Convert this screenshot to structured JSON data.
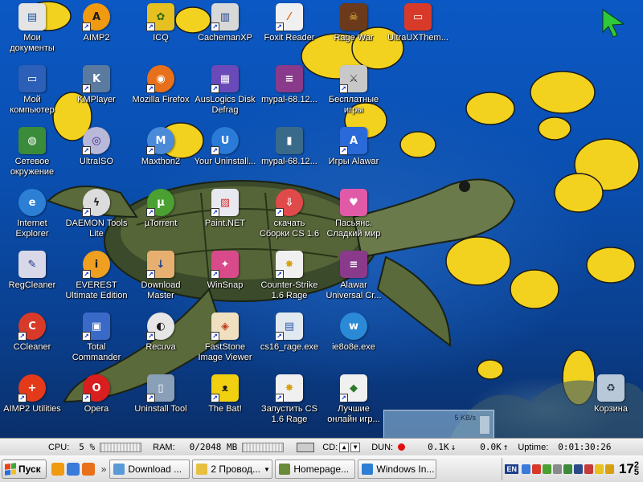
{
  "desktop": {
    "icons": [
      {
        "label": "Мои документы",
        "icon": "my-documents-icon",
        "color": "#e4e4e4",
        "fg": "#1d4f9b",
        "glyph": "▤",
        "shortcut": false
      },
      {
        "label": "Мой компьютер",
        "icon": "my-computer-icon",
        "color": "#2b5fb8",
        "fg": "#ffffff",
        "glyph": "▭",
        "shortcut": false
      },
      {
        "label": "Сетевое окружение",
        "icon": "network-icon",
        "color": "#3a8c3a",
        "fg": "#ffffff",
        "glyph": "◍",
        "shortcut": false
      },
      {
        "label": "Internet Explorer",
        "icon": "internet-explorer-icon",
        "color": "#2c7fd4",
        "fg": "#ffffff",
        "glyph": "e",
        "shortcut": false
      },
      {
        "label": "RegCleaner",
        "icon": "regcleaner-icon",
        "color": "#d8d8e8",
        "fg": "#1d2f8c",
        "glyph": "✎",
        "shortcut": false
      },
      {
        "label": "CCleaner",
        "icon": "ccleaner-icon",
        "color": "#d83a2a",
        "fg": "#ffffff",
        "glyph": "C",
        "shortcut": true
      },
      {
        "label": "AIMP2 Utilities",
        "icon": "aimp2-utilities-icon",
        "color": "#e43a1a",
        "fg": "#ffffff",
        "glyph": "+",
        "shortcut": true
      },
      {
        "label": "AIMP2",
        "icon": "aimp2-icon",
        "color": "#f09a10",
        "fg": "#1a1a1a",
        "glyph": "A",
        "shortcut": true
      },
      {
        "label": "KMPlayer",
        "icon": "kmplayer-icon",
        "color": "#5a7aa0",
        "fg": "#ffffff",
        "glyph": "K",
        "shortcut": true
      },
      {
        "label": "UltraISO",
        "icon": "ultraiso-icon",
        "color": "#b8b8d8",
        "fg": "#4a2a9a",
        "glyph": "◎",
        "shortcut": true
      },
      {
        "label": "DAEMON Tools Lite",
        "icon": "daemon-tools-icon",
        "color": "#dcdcdc",
        "fg": "#2a2a2a",
        "glyph": "ϟ",
        "shortcut": true
      },
      {
        "label": "EVEREST Ultimate Edition",
        "icon": "everest-icon",
        "color": "#f0a020",
        "fg": "#1a1a1a",
        "glyph": "i",
        "shortcut": true
      },
      {
        "label": "Total Commander",
        "icon": "total-commander-icon",
        "color": "#3a6ac8",
        "fg": "#ffffff",
        "glyph": "▣",
        "shortcut": true
      },
      {
        "label": "Opera",
        "icon": "opera-icon",
        "color": "#d81e1e",
        "fg": "#ffffff",
        "glyph": "O",
        "shortcut": true
      },
      {
        "label": "ICQ",
        "icon": "icq-icon",
        "color": "#e6c020",
        "fg": "#2a6a10",
        "glyph": "✿",
        "shortcut": true
      },
      {
        "label": "Mozilla Firefox",
        "icon": "firefox-icon",
        "color": "#e8701a",
        "fg": "#ffffff",
        "glyph": "◉",
        "shortcut": true
      },
      {
        "label": "Maxthon2",
        "icon": "maxthon-icon",
        "color": "#4a8ad8",
        "fg": "#ffffff",
        "glyph": "M",
        "shortcut": true
      },
      {
        "label": "µTorrent",
        "icon": "utorrent-icon",
        "color": "#4aa030",
        "fg": "#ffffff",
        "glyph": "µ",
        "shortcut": true
      },
      {
        "label": "Download Master",
        "icon": "download-master-icon",
        "color": "#e8b070",
        "fg": "#1d3f8c",
        "glyph": "↓",
        "shortcut": true
      },
      {
        "label": "Recuva",
        "icon": "recuva-icon",
        "color": "#e6e6e6",
        "fg": "#1a1a1a",
        "glyph": "◐",
        "shortcut": true
      },
      {
        "label": "Uninstall Tool",
        "icon": "uninstall-tool-icon",
        "color": "#8aa0b8",
        "fg": "#ffffff",
        "glyph": "▯",
        "shortcut": true
      },
      {
        "label": "CachemanXP",
        "icon": "cachemanxp-icon",
        "color": "#d8d8d8",
        "fg": "#1d3f8c",
        "glyph": "▥",
        "shortcut": true
      },
      {
        "label": "AusLogics Disk Defrag",
        "icon": "auslogics-defrag-icon",
        "color": "#6a4ab8",
        "fg": "#ffffff",
        "glyph": "▦",
        "shortcut": true
      },
      {
        "label": "Your Uninstall...",
        "icon": "your-uninstaller-icon",
        "color": "#2a7ad8",
        "fg": "#ffffff",
        "glyph": "U",
        "shortcut": true
      },
      {
        "label": "Paint.NET",
        "icon": "paint-net-icon",
        "color": "#e8e8f0",
        "fg": "#d82a2a",
        "glyph": "▨",
        "shortcut": true
      },
      {
        "label": "WinSnap",
        "icon": "winsnap-icon",
        "color": "#d84a8a",
        "fg": "#ffffff",
        "glyph": "✦",
        "shortcut": true
      },
      {
        "label": "FastStone Image Viewer",
        "icon": "faststone-icon",
        "color": "#f0e0c0",
        "fg": "#c03a1a",
        "glyph": "◈",
        "shortcut": true
      },
      {
        "label": "The Bat!",
        "icon": "the-bat-icon",
        "color": "#f0d010",
        "fg": "#1a1a1a",
        "glyph": "ᴥ",
        "shortcut": true
      },
      {
        "label": "Foxit Reader",
        "icon": "foxit-reader-icon",
        "color": "#f0f0f0",
        "fg": "#e06010",
        "glyph": "⁄",
        "shortcut": true
      },
      {
        "label": "mypal-68.12...",
        "icon": "winrar-archive-icon",
        "color": "#8a3a8a",
        "fg": "#ffffff",
        "glyph": "≡",
        "shortcut": false
      },
      {
        "label": "mypal-68.12...",
        "icon": "mypal-folder-icon",
        "color": "#3a6a8a",
        "fg": "#ffffff",
        "glyph": "▮",
        "shortcut": false
      },
      {
        "label": "скачать Сборки CS 1.6",
        "icon": "download-cs-icon",
        "color": "#e04a4a",
        "fg": "#ffffff",
        "glyph": "⇩",
        "shortcut": true
      },
      {
        "label": "Counter-Strike 1.6 Rage",
        "icon": "counter-strike-icon",
        "color": "#f0f0f0",
        "fg": "#d8a010",
        "glyph": "✸",
        "shortcut": true
      },
      {
        "label": "cs16_rage.exe",
        "icon": "cs16-exe-icon",
        "color": "#e0e8f0",
        "fg": "#2a5aa8",
        "glyph": "▤",
        "shortcut": true
      },
      {
        "label": "Запустить CS 1.6 Rage",
        "icon": "launch-cs-icon",
        "color": "#f0f0f0",
        "fg": "#d8a010",
        "glyph": "✸",
        "shortcut": true
      },
      {
        "label": "Rage War",
        "icon": "rage-war-icon",
        "color": "#6a3a1a",
        "fg": "#f0c040",
        "glyph": "☠",
        "shortcut": false
      },
      {
        "label": "Бесплатные игры",
        "icon": "free-games-icon",
        "color": "#c8c8c8",
        "fg": "#3a3a3a",
        "glyph": "⚔",
        "shortcut": true
      },
      {
        "label": "Игры Alawar",
        "icon": "alawar-games-icon",
        "color": "#2a6ad8",
        "fg": "#ffffff",
        "glyph": "A",
        "shortcut": true
      },
      {
        "label": "Пасьянс. Сладкий мир",
        "icon": "solitaire-icon",
        "color": "#e05aa8",
        "fg": "#ffffff",
        "glyph": "♥",
        "shortcut": false
      },
      {
        "label": "Alawar Universal Cr...",
        "icon": "alawar-installer-icon",
        "color": "#8a3a8a",
        "fg": "#ffffff",
        "glyph": "≡",
        "shortcut": false
      },
      {
        "label": "ie8o8e.exe",
        "icon": "ie8-exe-icon",
        "color": "#2a8ad8",
        "fg": "#ffffff",
        "glyph": "w",
        "shortcut": false
      },
      {
        "label": "Лучшие онлайн игр...",
        "icon": "online-games-icon",
        "color": "#f0f0f0",
        "fg": "#2a7a2a",
        "glyph": "◆",
        "shortcut": true
      },
      {
        "label": "UltraUXThem...",
        "icon": "ultrauxtheme-icon",
        "color": "#d83a2a",
        "fg": "#ffffff",
        "glyph": "▭",
        "shortcut": false
      },
      {
        "label": "Корзина",
        "icon": "recycle-bin-icon",
        "color": "#b8c8d8",
        "fg": "#2a3a4a",
        "glyph": "♻",
        "shortcut": false
      }
    ],
    "net_widget": {
      "speed": "5 KB/s"
    }
  },
  "monitor": {
    "cpu_label": "CPU:",
    "cpu_value": "5 %",
    "ram_label": "RAM:",
    "ram_value": "0/2048 MB",
    "cd_label": "CD:",
    "dun_label": "DUN:",
    "dun_down": "0.1K",
    "dun_up": "0.0K",
    "uptime_label": "Uptime:",
    "uptime_value": "0:01:30:26"
  },
  "taskbar": {
    "start_label": "Пуск",
    "quick_launch": [
      {
        "icon": "aimp-quicklaunch-icon",
        "color": "#f09a10"
      },
      {
        "icon": "show-desktop-icon",
        "color": "#3a7ad8"
      },
      {
        "icon": "firefox-quicklaunch-icon",
        "color": "#e8701a"
      }
    ],
    "overflow": "»",
    "tasks": [
      {
        "label": "Download ...",
        "icon": "download-task-icon",
        "color": "#5a9ad8"
      },
      {
        "label": "2 Провод...",
        "icon": "explorer-task-icon",
        "color": "#e8c040"
      },
      {
        "label": "Homepage...",
        "icon": "homepage-task-icon",
        "color": "#6a8a3a"
      },
      {
        "label": "Windows In...",
        "icon": "ie-task-icon",
        "color": "#2c7fd4"
      }
    ],
    "tray": {
      "lang": "EN",
      "icons": [
        {
          "icon": "network-tray-icon",
          "color": "#3a7ad8"
        },
        {
          "icon": "antivirus-tray-icon",
          "color": "#d83a2a"
        },
        {
          "icon": "utorrent-tray-icon",
          "color": "#4aa030"
        },
        {
          "icon": "volume-tray-icon",
          "color": "#8a8a8a"
        },
        {
          "icon": "safely-remove-tray-icon",
          "color": "#3a8a3a"
        },
        {
          "icon": "display-tray-icon",
          "color": "#2a4a8a"
        },
        {
          "icon": "lang-flag-tray-icon",
          "color": "#c83a3a"
        },
        {
          "icon": "warning-tray-icon",
          "color": "#e8c020"
        },
        {
          "icon": "tools-tray-icon",
          "color": "#d8a010"
        }
      ],
      "clock_hour": "17",
      "clock_min_top": "2",
      "clock_min_bottom": "5"
    }
  }
}
